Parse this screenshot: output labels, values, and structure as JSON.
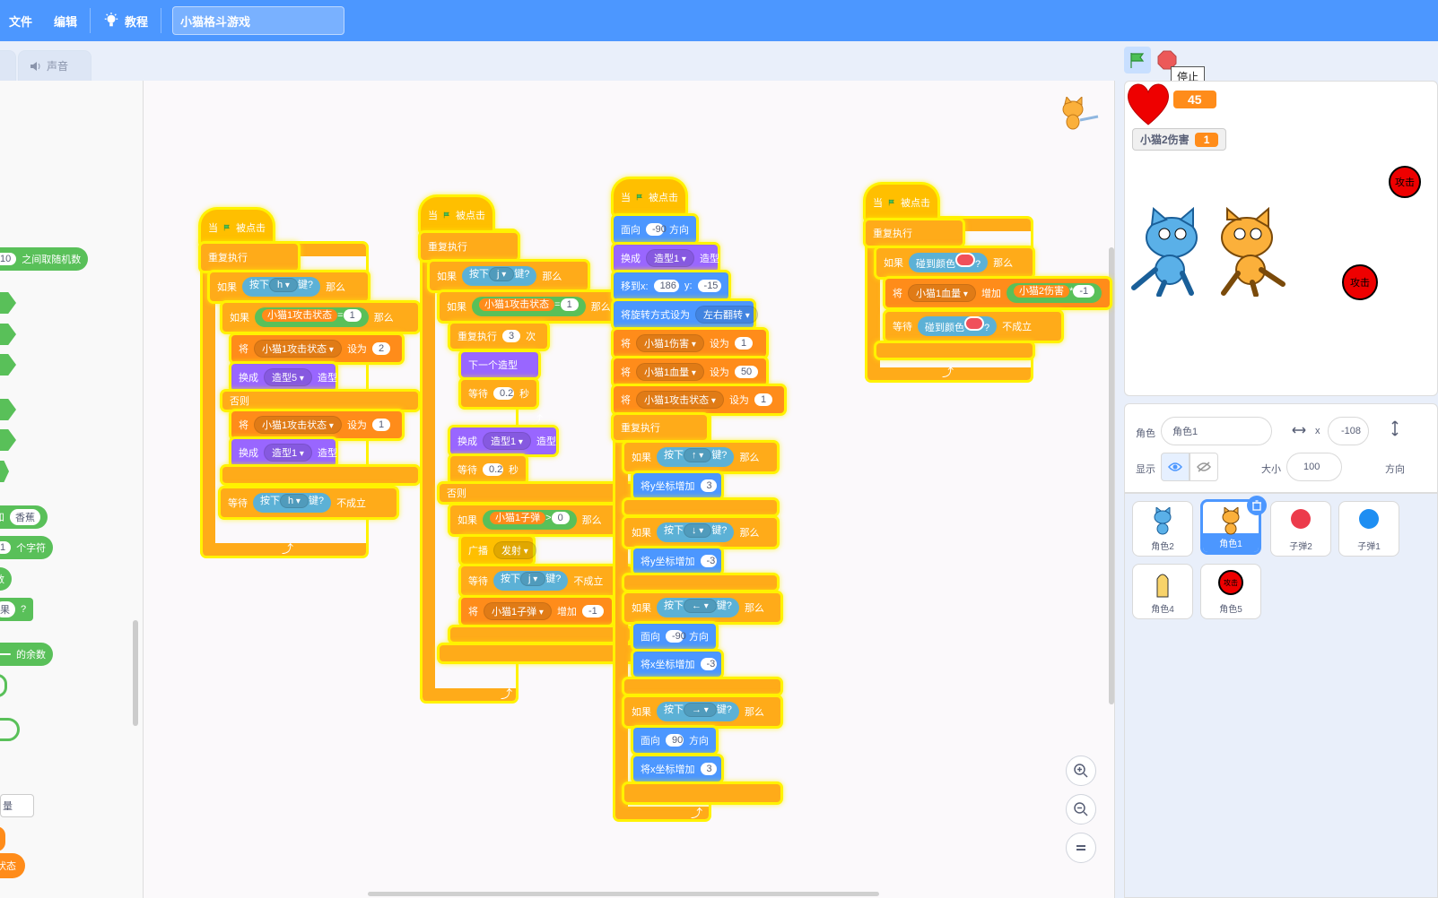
{
  "menu": {
    "file": "文件",
    "edit": "编辑",
    "tutorial": "教程",
    "project_title": "小猫格斗游戏"
  },
  "tabs": {
    "sound": "声音"
  },
  "palette": {
    "random_slot": "10",
    "random_text": "之间取随机数",
    "join_and": "和",
    "join_slot": "香蕉",
    "letter_slot": "1",
    "letter_text": "个字符",
    "number_text": "数",
    "contains_text": "果",
    "contains_q": "?",
    "mod_slot": "",
    "mod_text": "的余数",
    "var_field": "量",
    "var_state": "状态"
  },
  "scripts": {
    "s1": {
      "hat_when": "当",
      "hat_clicked": "被点击",
      "forever": "重复执行",
      "if": "如果",
      "key_press": "按下",
      "key_h": "h",
      "key_q": "键?",
      "then": "那么",
      "inner_if": "如果",
      "state_var": "小猫1攻击状态",
      "eq": "=",
      "one": "1",
      "then2": "那么",
      "set": "将",
      "set_var": "小猫1攻击状态",
      "set_to": "设为",
      "set_val": "2",
      "switch": "换成",
      "costume5": "造型5",
      "costume_word": "造型",
      "else": "否则",
      "set2": "将",
      "set2_var": "小猫1攻击状态",
      "set2_to": "设为",
      "set2_val": "1",
      "switch2": "换成",
      "costume1": "造型1",
      "costume_word2": "造型",
      "wait": "等待",
      "wait_key": "按下",
      "wait_h": "h",
      "wait_q": "键?",
      "until_not": "不成立"
    },
    "s2": {
      "hat_when": "当",
      "hat_clicked": "被点击",
      "forever": "重复执行",
      "if": "如果",
      "key_press": "按下",
      "key_j": "j",
      "key_q": "键?",
      "then": "那么",
      "inner_if": "如果",
      "state_var": "小猫1攻击状态",
      "eq": "=",
      "one": "1",
      "then2": "那么",
      "repeat": "重复执行",
      "repeat_n": "3",
      "times": "次",
      "next_costume": "下一个造型",
      "wait": "等待",
      "wait_n": "0.2",
      "sec": "秒",
      "switch": "换成",
      "costume1": "造型1",
      "costume_word": "造型",
      "wait2": "等待",
      "wait2_n": "0.2",
      "sec2": "秒",
      "else": "否则",
      "if2": "如果",
      "bullet_var": "小猫1子弹",
      "gt": ">",
      "zero": "0",
      "then3": "那么",
      "broadcast": "广播",
      "fire": "发射",
      "wait3": "等待",
      "wait3_key": "按下",
      "wait3_j": "j",
      "wait3_q": "键?",
      "until_not": "不成立",
      "change": "将",
      "change_var": "小猫1子弹",
      "change_by": "增加",
      "change_val": "-1"
    },
    "s3": {
      "hat_when": "当",
      "hat_clicked": "被点击",
      "point": "面向",
      "point_val": "-90",
      "direction": "方向",
      "switch": "换成",
      "costume1": "造型1",
      "costume_word": "造型",
      "goto": "移到x:",
      "x_val": "186",
      "y_lbl": "y:",
      "y_val": "-15",
      "rot": "将旋转方式设为",
      "rot_val": "左右翻转",
      "set_a": "将",
      "set_a_var": "小猫1伤害",
      "set_a_to": "设为",
      "set_a_val": "1",
      "set_b": "将",
      "set_b_var": "小猫1血量",
      "set_b_to": "设为",
      "set_b_val": "50",
      "set_c": "将",
      "set_c_var": "小猫1攻击状态",
      "set_c_to": "设为",
      "set_c_val": "1",
      "forever": "重复执行",
      "if_up": "如果",
      "press": "按下",
      "up": "↑",
      "key_q": "键?",
      "then": "那么",
      "y_add": "将y坐标增加",
      "y_add_val": "3",
      "if_down": "如果",
      "down": "↓",
      "y_sub_val": "-3",
      "if_left": "如果",
      "left": "←",
      "face_l_val": "-90",
      "x_add": "将x坐标增加",
      "x_sub_val": "-3",
      "if_right": "如果",
      "right": "→",
      "face_r_val": "90",
      "x_add_val": "3"
    },
    "s4": {
      "hat_when": "当",
      "hat_clicked": "被点击",
      "forever": "重复执行",
      "if": "如果",
      "touch_color": "碰到颜色",
      "q": "?",
      "then": "那么",
      "change": "将",
      "hp_var": "小猫1血量",
      "change_by": "增加",
      "dmg_var": "小猫2伤害",
      "mul": "*",
      "neg1": "-1",
      "wait": "等待",
      "wait_touch": "碰到颜色",
      "wait_q": "?",
      "until_not": "不成立"
    }
  },
  "stage": {
    "tooltip": "停止",
    "hp_value": "45",
    "dmg_label": "小猫2伤害",
    "dmg_value": "1",
    "attack": "攻击"
  },
  "sprite_info": {
    "sprite_label": "角色",
    "sprite_name": "角色1",
    "x_label": "x",
    "x_val": "-108",
    "show_label": "显示",
    "size_label": "大小",
    "size_val": "100",
    "dir_label": "方向"
  },
  "sprites": [
    "角色2",
    "角色1",
    "子弹2",
    "子弹1",
    "角色4",
    "角色5"
  ],
  "sprite5_text": "攻击"
}
